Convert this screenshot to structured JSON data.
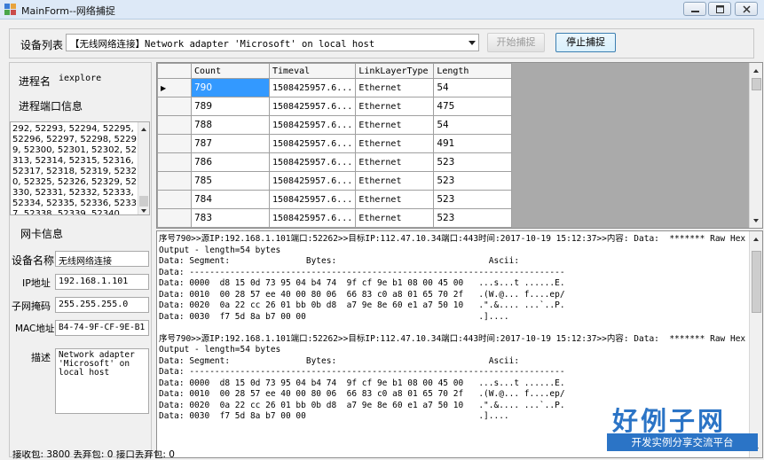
{
  "window": {
    "title": "MainForm--网络捕捉"
  },
  "device_row": {
    "label": "设备列表",
    "selected_device": "【无线网络连接】Network adapter 'Microsoft' on local host",
    "start_button": "开始捕捉",
    "stop_button": "停止捕捉"
  },
  "left_panel": {
    "process_name_label": "进程名",
    "process_name_value": "iexplore",
    "process_ports_label": "进程端口信息",
    "process_ports_value": "292, 52293, 52294, 52295, 52296, 52297, 52298, 52299, 52300, 52301, 52302, 52313, 52314, 52315, 52316, 52317, 52318, 52319, 52320, 52325, 52326, 52329, 52330, 52331, 52332, 52333, 52334, 52335, 52336, 52337, 52338, 52339, 52340,",
    "nic_info_label": "网卡信息",
    "device_name_label": "设备名称",
    "device_name_value": "无线网络连接",
    "ip_label": "IP地址",
    "ip_value": "192.168.1.101",
    "subnet_label": "子网掩码",
    "subnet_value": "255.255.255.0",
    "mac_label": "MAC地址",
    "mac_value": "B4-74-9F-CF-9E-B1",
    "desc_label": "描述",
    "desc_value": "Network adapter 'Microsoft' on local host"
  },
  "grid": {
    "columns": [
      "Count",
      "Timeval",
      "LinkLayerType",
      "Length"
    ],
    "rows": [
      {
        "count": "790",
        "timeval": "1508425957.6...",
        "type": "Ethernet",
        "length": "54",
        "row_marker": "▶"
      },
      {
        "count": "789",
        "timeval": "1508425957.6...",
        "type": "Ethernet",
        "length": "475",
        "row_marker": ""
      },
      {
        "count": "788",
        "timeval": "1508425957.6...",
        "type": "Ethernet",
        "length": "54",
        "row_marker": ""
      },
      {
        "count": "787",
        "timeval": "1508425957.6...",
        "type": "Ethernet",
        "length": "491",
        "row_marker": ""
      },
      {
        "count": "786",
        "timeval": "1508425957.6...",
        "type": "Ethernet",
        "length": "523",
        "row_marker": ""
      },
      {
        "count": "785",
        "timeval": "1508425957.6...",
        "type": "Ethernet",
        "length": "523",
        "row_marker": ""
      },
      {
        "count": "784",
        "timeval": "1508425957.6...",
        "type": "Ethernet",
        "length": "523",
        "row_marker": ""
      },
      {
        "count": "783",
        "timeval": "1508425957.6...",
        "type": "Ethernet",
        "length": "523",
        "row_marker": ""
      }
    ]
  },
  "log": {
    "lines": [
      "序号790>>源IP:192.168.1.101端口:52262>>目标IP:112.47.10.34端口:443时间:2017-10-19 15:12:37>>内容: Data:  ******* Raw Hex",
      "Output - length=54 bytes",
      "Data: Segment:               Bytes:                              Ascii:",
      "Data: --------------------------------------------------------------------------",
      "Data: 0000  d8 15 0d 73 95 04 b4 74  9f cf 9e b1 08 00 45 00   ...s...t ......E.",
      "Data: 0010  00 28 57 ee 40 00 80 06  66 83 c0 a8 01 65 70 2f   .(W.@... f....ep/",
      "Data: 0020  0a 22 cc 26 01 bb 0b d8  a7 9e 8e 60 e1 a7 50 10   .\".&.... ...`..P.",
      "Data: 0030  f7 5d 8a b7 00 00                                  .]....",
      "",
      "序号790>>源IP:192.168.1.101端口:52262>>目标IP:112.47.10.34端口:443时间:2017-10-19 15:12:37>>内容: Data:  ******* Raw Hex",
      "Output - length=54 bytes",
      "Data: Segment:               Bytes:                              Ascii:",
      "Data: --------------------------------------------------------------------------",
      "Data: 0000  d8 15 0d 73 95 04 b4 74  9f cf 9e b1 08 00 45 00   ...s...t ......E.",
      "Data: 0010  00 28 57 ee 40 00 80 06  66 83 c0 a8 01 65 70 2f   .(W.@... f....ep/",
      "Data: 0020  0a 22 cc 26 01 bb 0b d8  a7 9e 8e 60 e1 a7 50 10   .\".&.... ...`..P.",
      "Data: 0030  f7 5d 8a b7 00 00                                  .]...."
    ]
  },
  "status": {
    "text": "接收包: 3800  丢弃包: 0  接口丢弃包: 0"
  },
  "watermark": {
    "brand": "好例子网",
    "tagline": "开发实例分享交流平台"
  },
  "colors": {
    "selection": "#3399ff",
    "brand_blue": "#2b74c6",
    "titlebar": "#dde9f7"
  },
  "icons": [
    "app-icon",
    "minimize-icon",
    "maximize-icon",
    "close-icon",
    "dropdown-arrow-icon",
    "row-pointer-icon"
  ]
}
